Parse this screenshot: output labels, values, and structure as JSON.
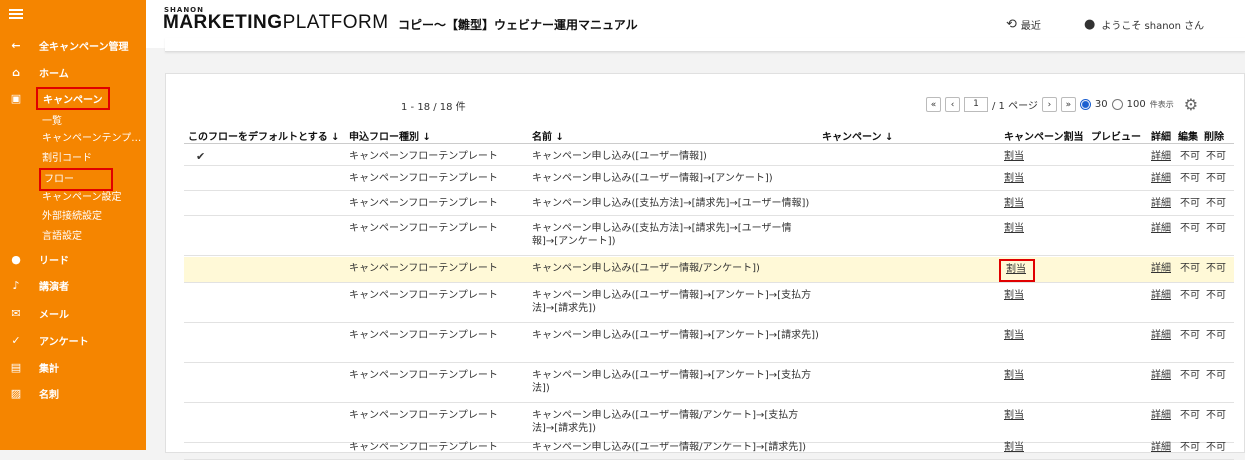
{
  "app": {
    "logo_small": "SHANON",
    "logo_bold": "MARKETING",
    "logo_light": "PLATFORM",
    "page_title": "コピー～【雛型】ウェビナー運用マニュアル",
    "recent_label": "最近",
    "welcome_label": "ようこそ shanon さん"
  },
  "sidebar": {
    "back_label": "全キャンペーン管理",
    "items": [
      {
        "icon": "home-icon",
        "label": "ホーム"
      },
      {
        "icon": "calendar-icon",
        "label": "キャンペーン"
      },
      {
        "icon": "person-icon",
        "label": "リード"
      },
      {
        "icon": "microphone-icon",
        "label": "講演者"
      },
      {
        "icon": "mail-icon",
        "label": "メール"
      },
      {
        "icon": "check-icon",
        "label": "アンケート"
      },
      {
        "icon": "chart-icon",
        "label": "集計"
      },
      {
        "icon": "card-icon",
        "label": "名刺"
      }
    ],
    "campaign_sub": [
      "一覧",
      "キャンペーンテンプ…",
      "割引コード",
      "フロー",
      "キャンペーン設定",
      "外部接続設定",
      "言語設定"
    ]
  },
  "list": {
    "count": "1 - 18 / 18 件",
    "page_value": "1",
    "page_total": "/ 1 ページ",
    "per_page_options": [
      "30",
      "100"
    ],
    "per_page_selected": "30",
    "per_page_suffix": "件表示"
  },
  "table": {
    "headers": [
      "このフローをデフォルトとする ↓",
      "申込フロー種別 ↓",
      "名前 ↓",
      "キャンペーン ↓",
      "キャンペーン割当",
      "プレビュー",
      "詳細",
      "編集",
      "削除"
    ],
    "rows": [
      {
        "default": "✔",
        "type": "キャンペーンフローテンプレート",
        "name": "キャンペーン申し込み([ユーザー情報])",
        "assign": "割当",
        "detail": "詳細",
        "edit": "不可",
        "del": "不可"
      },
      {
        "default": "",
        "type": "キャンペーンフローテンプレート",
        "name": "キャンペーン申し込み([ユーザー情報]→[アンケート])",
        "assign": "割当",
        "detail": "詳細",
        "edit": "不可",
        "del": "不可"
      },
      {
        "default": "",
        "type": "キャンペーンフローテンプレート",
        "name": "キャンペーン申し込み([支払方法]→[請求先]→[ユーザー情報])",
        "assign": "割当",
        "detail": "詳細",
        "edit": "不可",
        "del": "不可"
      },
      {
        "default": "",
        "type": "キャンペーンフローテンプレート",
        "name": "キャンペーン申し込み([支払方法]→[請求先]→[ユーザー情報]→[アンケート])",
        "assign": "割当",
        "detail": "詳細",
        "edit": "不可",
        "del": "不可"
      },
      {
        "default": "",
        "type": "キャンペーンフローテンプレート",
        "name": "キャンペーン申し込み([ユーザー情報/アンケート])",
        "assign": "割当",
        "detail": "詳細",
        "edit": "不可",
        "del": "不可"
      },
      {
        "default": "",
        "type": "キャンペーンフローテンプレート",
        "name": "キャンペーン申し込み([ユーザー情報]→[アンケート]→[支払方法]→[請求先])",
        "assign": "割当",
        "detail": "詳細",
        "edit": "不可",
        "del": "不可"
      },
      {
        "default": "",
        "type": "キャンペーンフローテンプレート",
        "name": "キャンペーン申し込み([ユーザー情報]→[アンケート]→[請求先])",
        "assign": "割当",
        "detail": "詳細",
        "edit": "不可",
        "del": "不可"
      },
      {
        "default": "",
        "type": "キャンペーンフローテンプレート",
        "name": "キャンペーン申し込み([ユーザー情報]→[アンケート]→[支払方法])",
        "assign": "割当",
        "detail": "詳細",
        "edit": "不可",
        "del": "不可"
      },
      {
        "default": "",
        "type": "キャンペーンフローテンプレート",
        "name": "キャンペーン申し込み([ユーザー情報/アンケート]→[支払方法]→[請求先])",
        "assign": "割当",
        "detail": "詳細",
        "edit": "不可",
        "del": "不可"
      },
      {
        "default": "",
        "type": "キャンペーンフローテンプレート",
        "name": "キャンペーン申し込み([ユーザー情報/アンケート]→[請求先])",
        "assign": "割当",
        "detail": "詳細",
        "edit": "不可",
        "del": "不可"
      }
    ]
  },
  "colors": {
    "accent": "#f58500",
    "highlight_row": "#fff9d7",
    "annotation": "#e00000"
  }
}
